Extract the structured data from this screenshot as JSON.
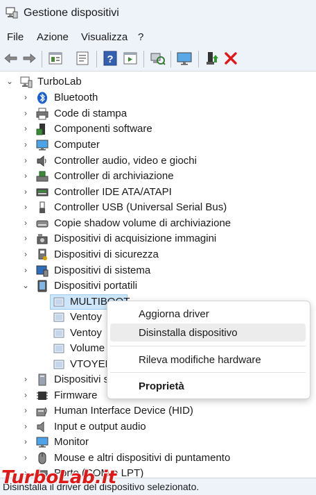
{
  "window": {
    "title": "Gestione dispositivi"
  },
  "menubar": [
    "File",
    "Azione",
    "Visualizza",
    "?"
  ],
  "toolbar": {
    "buttons": [
      "back-icon",
      "forward-icon",
      "properties-panel-icon",
      "document-icon",
      "help-icon",
      "view-panel-icon",
      "scan-hardware-icon",
      "monitor-icon",
      "enable-device-icon",
      "uninstall-x-icon"
    ],
    "accent_red": "#e01818"
  },
  "tree": {
    "root": "TurboLab",
    "categories": [
      "Bluetooth",
      "Code di stampa",
      "Componenti software",
      "Computer",
      "Controller audio, video e giochi",
      "Controller di archiviazione",
      "Controller IDE ATA/ATAPI",
      "Controller USB (Universal Serial Bus)",
      "Copie shadow volume di archiviazione",
      "Dispositivi di acquisizione immagini",
      "Dispositivi di sicurezza",
      "Dispositivi di sistema",
      "Dispositivi portatili"
    ],
    "portable_children": [
      "MULTIBOOT",
      "Ventoy",
      "Ventoy",
      "Volume",
      "VTOYEFI"
    ],
    "categories_after": [
      "Dispositivi s",
      "Firmware",
      "Human Interface Device (HID)",
      "Input e output audio",
      "Monitor",
      "Mouse e altri dispositivi di puntamento",
      "Porte (COM e LPT)"
    ],
    "selection_color": "#cde6fb"
  },
  "context_menu": {
    "items": [
      "Aggiorna driver",
      "Disinstalla dispositivo",
      "Rileva modifiche hardware",
      "Proprietà"
    ]
  },
  "statusbar": {
    "text": "Disinstalla il driver del dispositivo selezionato."
  },
  "watermark": "TurboLab.it"
}
